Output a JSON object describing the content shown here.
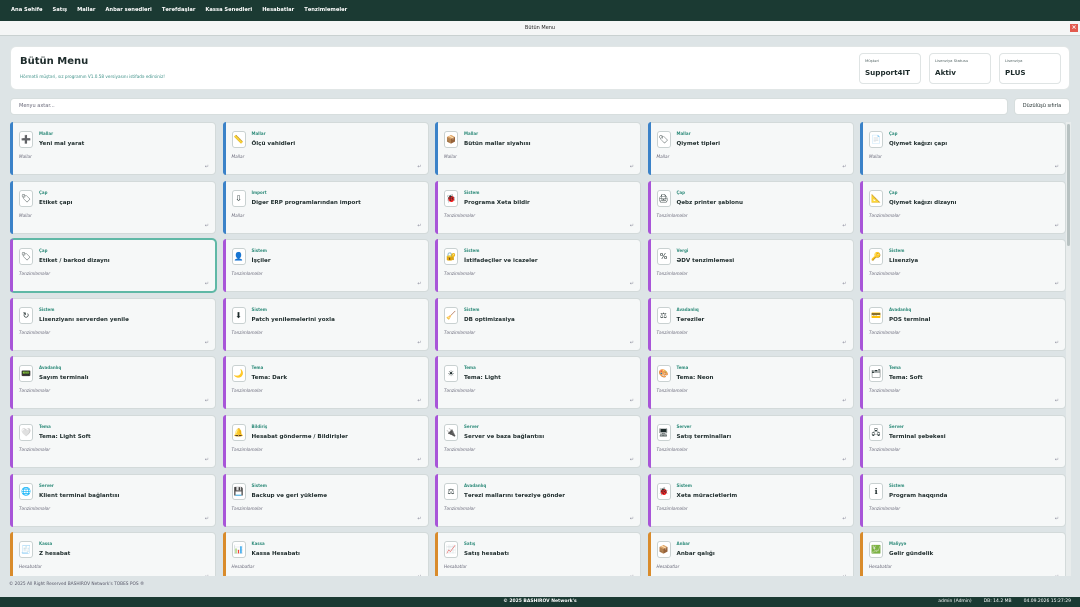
{
  "menubar": [
    "Ana Səhifə",
    "Satış",
    "Mallar",
    "Anbar sənədləri",
    "Tərəfdaşlar",
    "Kassa Sənədləri",
    "Hesabatlar",
    "Tənzimləmələr"
  ],
  "window_title": "Bütün Menu",
  "close_glyph": "×",
  "header": {
    "title": "Bütün Menu",
    "subtitle": "Hörmətli müştəri, sız programın V1.0.58 versiyasını istifadə edirsiniz!",
    "customer_label": "Müştəri",
    "customer_value": "Support4IT",
    "license_status_label": "Lisenziya Statusu",
    "license_status_value": "Aktiv",
    "license_label": "Lisenziya",
    "license_value": "PLUS"
  },
  "search": {
    "placeholder": "Menyu axtar..."
  },
  "reset_label": "Düzülüşü sıfırla",
  "return_glyph": "↵",
  "cards": [
    {
      "cat": "Mallar",
      "name": "Yeni mal yarat",
      "group": "Mallar",
      "icon": "➕",
      "icon_name": "plus-icon",
      "color": "#3b82c8"
    },
    {
      "cat": "Mallar",
      "name": "Ölçü vahidləri",
      "group": "Mallar",
      "icon": "📏",
      "icon_name": "ruler-icon",
      "color": "#3b82c8"
    },
    {
      "cat": "Mallar",
      "name": "Bütün mallar siyahısı",
      "group": "Mallar",
      "icon": "📦",
      "icon_name": "box-icon",
      "color": "#3b82c8"
    },
    {
      "cat": "Mallar",
      "name": "Qiymət tipləri",
      "group": "Mallar",
      "icon": "🏷",
      "icon_name": "tag-icon",
      "color": "#3b82c8"
    },
    {
      "cat": "Çap",
      "name": "Qiymət kağızı çapı",
      "group": "Mallar",
      "icon": "📄",
      "icon_name": "paper-icon",
      "color": "#3b82c8"
    },
    {
      "cat": "Çap",
      "name": "Etiket çapı",
      "group": "Mallar",
      "icon": "🏷",
      "icon_name": "label-icon",
      "color": "#3b82c8"
    },
    {
      "cat": "Import",
      "name": "Digər ERP programlarından import",
      "group": "Mallar",
      "icon": "⇩",
      "icon_name": "import-icon",
      "color": "#3b82c8"
    },
    {
      "cat": "Sistem",
      "name": "Programa Xəta bildir",
      "group": "Tənzimləmələr",
      "icon": "🐞",
      "icon_name": "bug-icon",
      "color": "#a855d8"
    },
    {
      "cat": "Çap",
      "name": "Qəbz printer şablonu",
      "group": "Tənzimləmələr",
      "icon": "🖨",
      "icon_name": "printer-icon",
      "color": "#a855d8"
    },
    {
      "cat": "Çap",
      "name": "Qiymət kağızı dizaynı",
      "group": "Tənzimləmələr",
      "icon": "📐",
      "icon_name": "design-icon",
      "color": "#a855d8"
    },
    {
      "cat": "Çap",
      "name": "Etiket / barkod dizaynı",
      "group": "Tənzimləmələr",
      "icon": "🏷",
      "icon_name": "barcode-icon",
      "color": "#a855d8"
    },
    {
      "cat": "Sistem",
      "name": "İşçilər",
      "group": "Tənzimləmələr",
      "icon": "👤",
      "icon_name": "user-icon",
      "color": "#a855d8"
    },
    {
      "cat": "Sistem",
      "name": "İstifadəçilər və icazələr",
      "group": "Tənzimləmələr",
      "icon": "🔐",
      "icon_name": "permissions-icon",
      "color": "#a855d8"
    },
    {
      "cat": "Vergi",
      "name": "ƏDV tənzimləməsi",
      "group": "Tənzimləmələr",
      "icon": "%",
      "icon_name": "percent-icon",
      "color": "#a855d8"
    },
    {
      "cat": "Sistem",
      "name": "Lisenziya",
      "group": "Tənzimləmələr",
      "icon": "🔑",
      "icon_name": "key-icon",
      "color": "#a855d8"
    },
    {
      "cat": "Sistem",
      "name": "Lisenziyanı serverdən yenilə",
      "group": "Tənzimləmələr",
      "icon": "↻",
      "icon_name": "refresh-icon",
      "color": "#a855d8"
    },
    {
      "cat": "Sistem",
      "name": "Patch yeniləmələrini yoxla",
      "group": "Tənzimləmələr",
      "icon": "⬇",
      "icon_name": "download-icon",
      "color": "#a855d8"
    },
    {
      "cat": "Sistem",
      "name": "DB optimizasiya",
      "group": "Tənzimləmələr",
      "icon": "🧹",
      "icon_name": "broom-icon",
      "color": "#a855d8"
    },
    {
      "cat": "Avadanlıq",
      "name": "Tərəzilər",
      "group": "Tənzimləmələr",
      "icon": "⚖",
      "icon_name": "scale-icon",
      "color": "#a855d8"
    },
    {
      "cat": "Avadanlıq",
      "name": "POS terminal",
      "group": "Tənzimləmələr",
      "icon": "💳",
      "icon_name": "card-icon",
      "color": "#a855d8"
    },
    {
      "cat": "Avadanlıq",
      "name": "Sayım terminalı",
      "group": "Tənzimləmələr",
      "icon": "📟",
      "icon_name": "terminal-icon",
      "color": "#a855d8"
    },
    {
      "cat": "Tema",
      "name": "Tema: Dark",
      "group": "Tənzimləmələr",
      "icon": "🌙",
      "icon_name": "moon-icon",
      "color": "#a855d8"
    },
    {
      "cat": "Tema",
      "name": "Tema: Light",
      "group": "Tənzimləmələr",
      "icon": "☀",
      "icon_name": "sun-icon",
      "color": "#a855d8"
    },
    {
      "cat": "Tema",
      "name": "Tema: Neon",
      "group": "Tənzimləmələr",
      "icon": "🎨",
      "icon_name": "palette-icon",
      "color": "#a855d8"
    },
    {
      "cat": "Tema",
      "name": "Tema: Soft",
      "group": "Tənzimləmələr",
      "icon": "🗂",
      "icon_name": "soft-theme-icon",
      "color": "#a855d8"
    },
    {
      "cat": "Tema",
      "name": "Tema: Light Soft",
      "group": "Tənzimləmələr",
      "icon": "🤍",
      "icon_name": "heart-icon",
      "color": "#a855d8"
    },
    {
      "cat": "Bildiriş",
      "name": "Hesabat göndərmə / Bildirişlər",
      "group": "Tənzimləmələr",
      "icon": "🔔",
      "icon_name": "bell-icon",
      "color": "#a855d8"
    },
    {
      "cat": "Server",
      "name": "Server və baza bağlantısı",
      "group": "Tənzimləmələr",
      "icon": "🔌",
      "icon_name": "plug-icon",
      "color": "#a855d8"
    },
    {
      "cat": "Server",
      "name": "Satış terminalları",
      "group": "Tənzimləmələr",
      "icon": "🖥",
      "icon_name": "monitor-icon",
      "color": "#a855d8"
    },
    {
      "cat": "Server",
      "name": "Terminal şəbəkəsi",
      "group": "Tənzimləmələr",
      "icon": "🖧",
      "icon_name": "network-icon",
      "color": "#a855d8"
    },
    {
      "cat": "Server",
      "name": "Klient terminal bağlantısı",
      "group": "Tənzimləmələr",
      "icon": "🌐",
      "icon_name": "globe-icon",
      "color": "#a855d8"
    },
    {
      "cat": "Sistem",
      "name": "Backup və geri yükləmə",
      "group": "Tənzimləmələr",
      "icon": "💾",
      "icon_name": "backup-icon",
      "color": "#a855d8"
    },
    {
      "cat": "Avadanlıq",
      "name": "Tərəzi mallarını tərəziyə göndər",
      "group": "Tənzimləmələr",
      "icon": "⚖",
      "icon_name": "scale-send-icon",
      "color": "#a855d8"
    },
    {
      "cat": "Sistem",
      "name": "Xəta müraciətlərim",
      "group": "Tənzimləmələr",
      "icon": "🐞",
      "icon_name": "bug-report-icon",
      "color": "#a855d8"
    },
    {
      "cat": "Sistem",
      "name": "Program haqqında",
      "group": "Tənzimləmələr",
      "icon": "ℹ",
      "icon_name": "info-icon",
      "color": "#a855d8"
    },
    {
      "cat": "Kassa",
      "name": "Z hesabat",
      "group": "Hesabatlar",
      "icon": "🧾",
      "icon_name": "receipt-icon",
      "color": "#d98b2b"
    },
    {
      "cat": "Kassa",
      "name": "Kassa Hesabatı",
      "group": "Hesabatlar",
      "icon": "📊",
      "icon_name": "bar-chart-icon",
      "color": "#d98b2b"
    },
    {
      "cat": "Satış",
      "name": "Satış hesabatı",
      "group": "Hesabatlar",
      "icon": "📈",
      "icon_name": "line-chart-icon",
      "color": "#d98b2b"
    },
    {
      "cat": "Anbar",
      "name": "Anbar qalığı",
      "group": "Hesabatlar",
      "icon": "📦",
      "icon_name": "warehouse-icon",
      "color": "#d98b2b"
    },
    {
      "cat": "Maliyyə",
      "name": "Gəlir gündəlik",
      "group": "Hesabatlar",
      "icon": "💹",
      "icon_name": "income-icon",
      "color": "#d98b2b"
    }
  ],
  "footer": "© 2025 All Right Reserved BASHIROV Network's  TOBES POS ®",
  "status": {
    "center": "© 2025 BASHIROV Network's",
    "user": "admin (Admin)",
    "db": "DB: 14.2 MB",
    "datetime": "04.09.2026  15:27:29"
  }
}
